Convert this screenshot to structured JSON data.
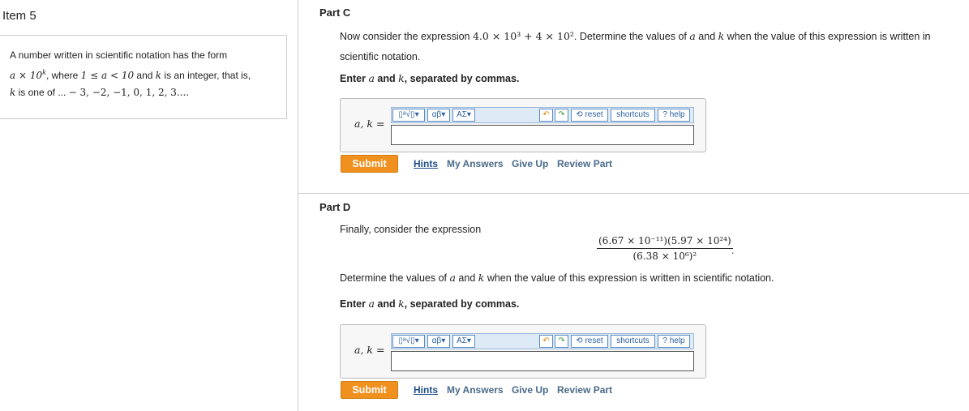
{
  "item": {
    "title": "Item 5"
  },
  "intro": {
    "line1": "A number written in scientific notation has the form",
    "line2_a": "a × 10",
    "line2_k": "k",
    "line2_rest": ", where ",
    "line2_ineq": "1 ≤ a < 10",
    "line2_tail": " and ",
    "line2_k2": "k",
    "line2_end": " is an integer, that is,",
    "line3_k": "k",
    "line3_rest": " is one of ... ",
    "line3_list": "− 3, −2, −1, 0, 1, 2, 3...."
  },
  "partC": {
    "title": "Part C",
    "text_pre": "Now consider the expression ",
    "expr": "4.0 × 10³ + 4 × 10²",
    "text_post": ". Determine the values of ",
    "var_a": "a",
    "and": " and ",
    "var_k": "k",
    "text_end": " when the value of this expression is written in",
    "line2": "scientific notation.",
    "enter_pre": "Enter ",
    "enter_a": "a",
    "enter_and": " and ",
    "enter_k": "k",
    "enter_post": ", separated by commas.",
    "label": "a, k =",
    "submit": "Submit"
  },
  "partD": {
    "title": "Part D",
    "intro": "Finally, consider the expression",
    "numerator": "(6.67 × 10⁻¹¹)(5.97 × 10²⁴)",
    "denominator": "(6.38 × 10⁶)²",
    "period": ".",
    "det_pre": "Determine the values of ",
    "det_a": "a",
    "det_and": " and ",
    "det_k": "k",
    "det_post": " when the value of this expression is written in scientific notation.",
    "enter_pre": "Enter ",
    "enter_a": "a",
    "enter_and": " and ",
    "enter_k": "k",
    "enter_post": ", separated by commas.",
    "label": "a, k =",
    "submit": "Submit"
  },
  "toolbar": {
    "templates": "▯ᵃ√▯▾",
    "greek": "αβ▾",
    "symbols": "ΑΣ▾",
    "undo_icon": "undo-icon",
    "redo_icon": "redo-icon",
    "reset": "⟲ reset",
    "shortcuts": "shortcuts",
    "help": "? help"
  },
  "links": {
    "hints": "Hints",
    "my_answers": "My Answers",
    "give_up": "Give Up",
    "review_part": "Review Part"
  },
  "colors": {
    "submit": "#f0901e",
    "toolbar_bg": "#dfeaf7",
    "link": "#4a6b8a"
  }
}
